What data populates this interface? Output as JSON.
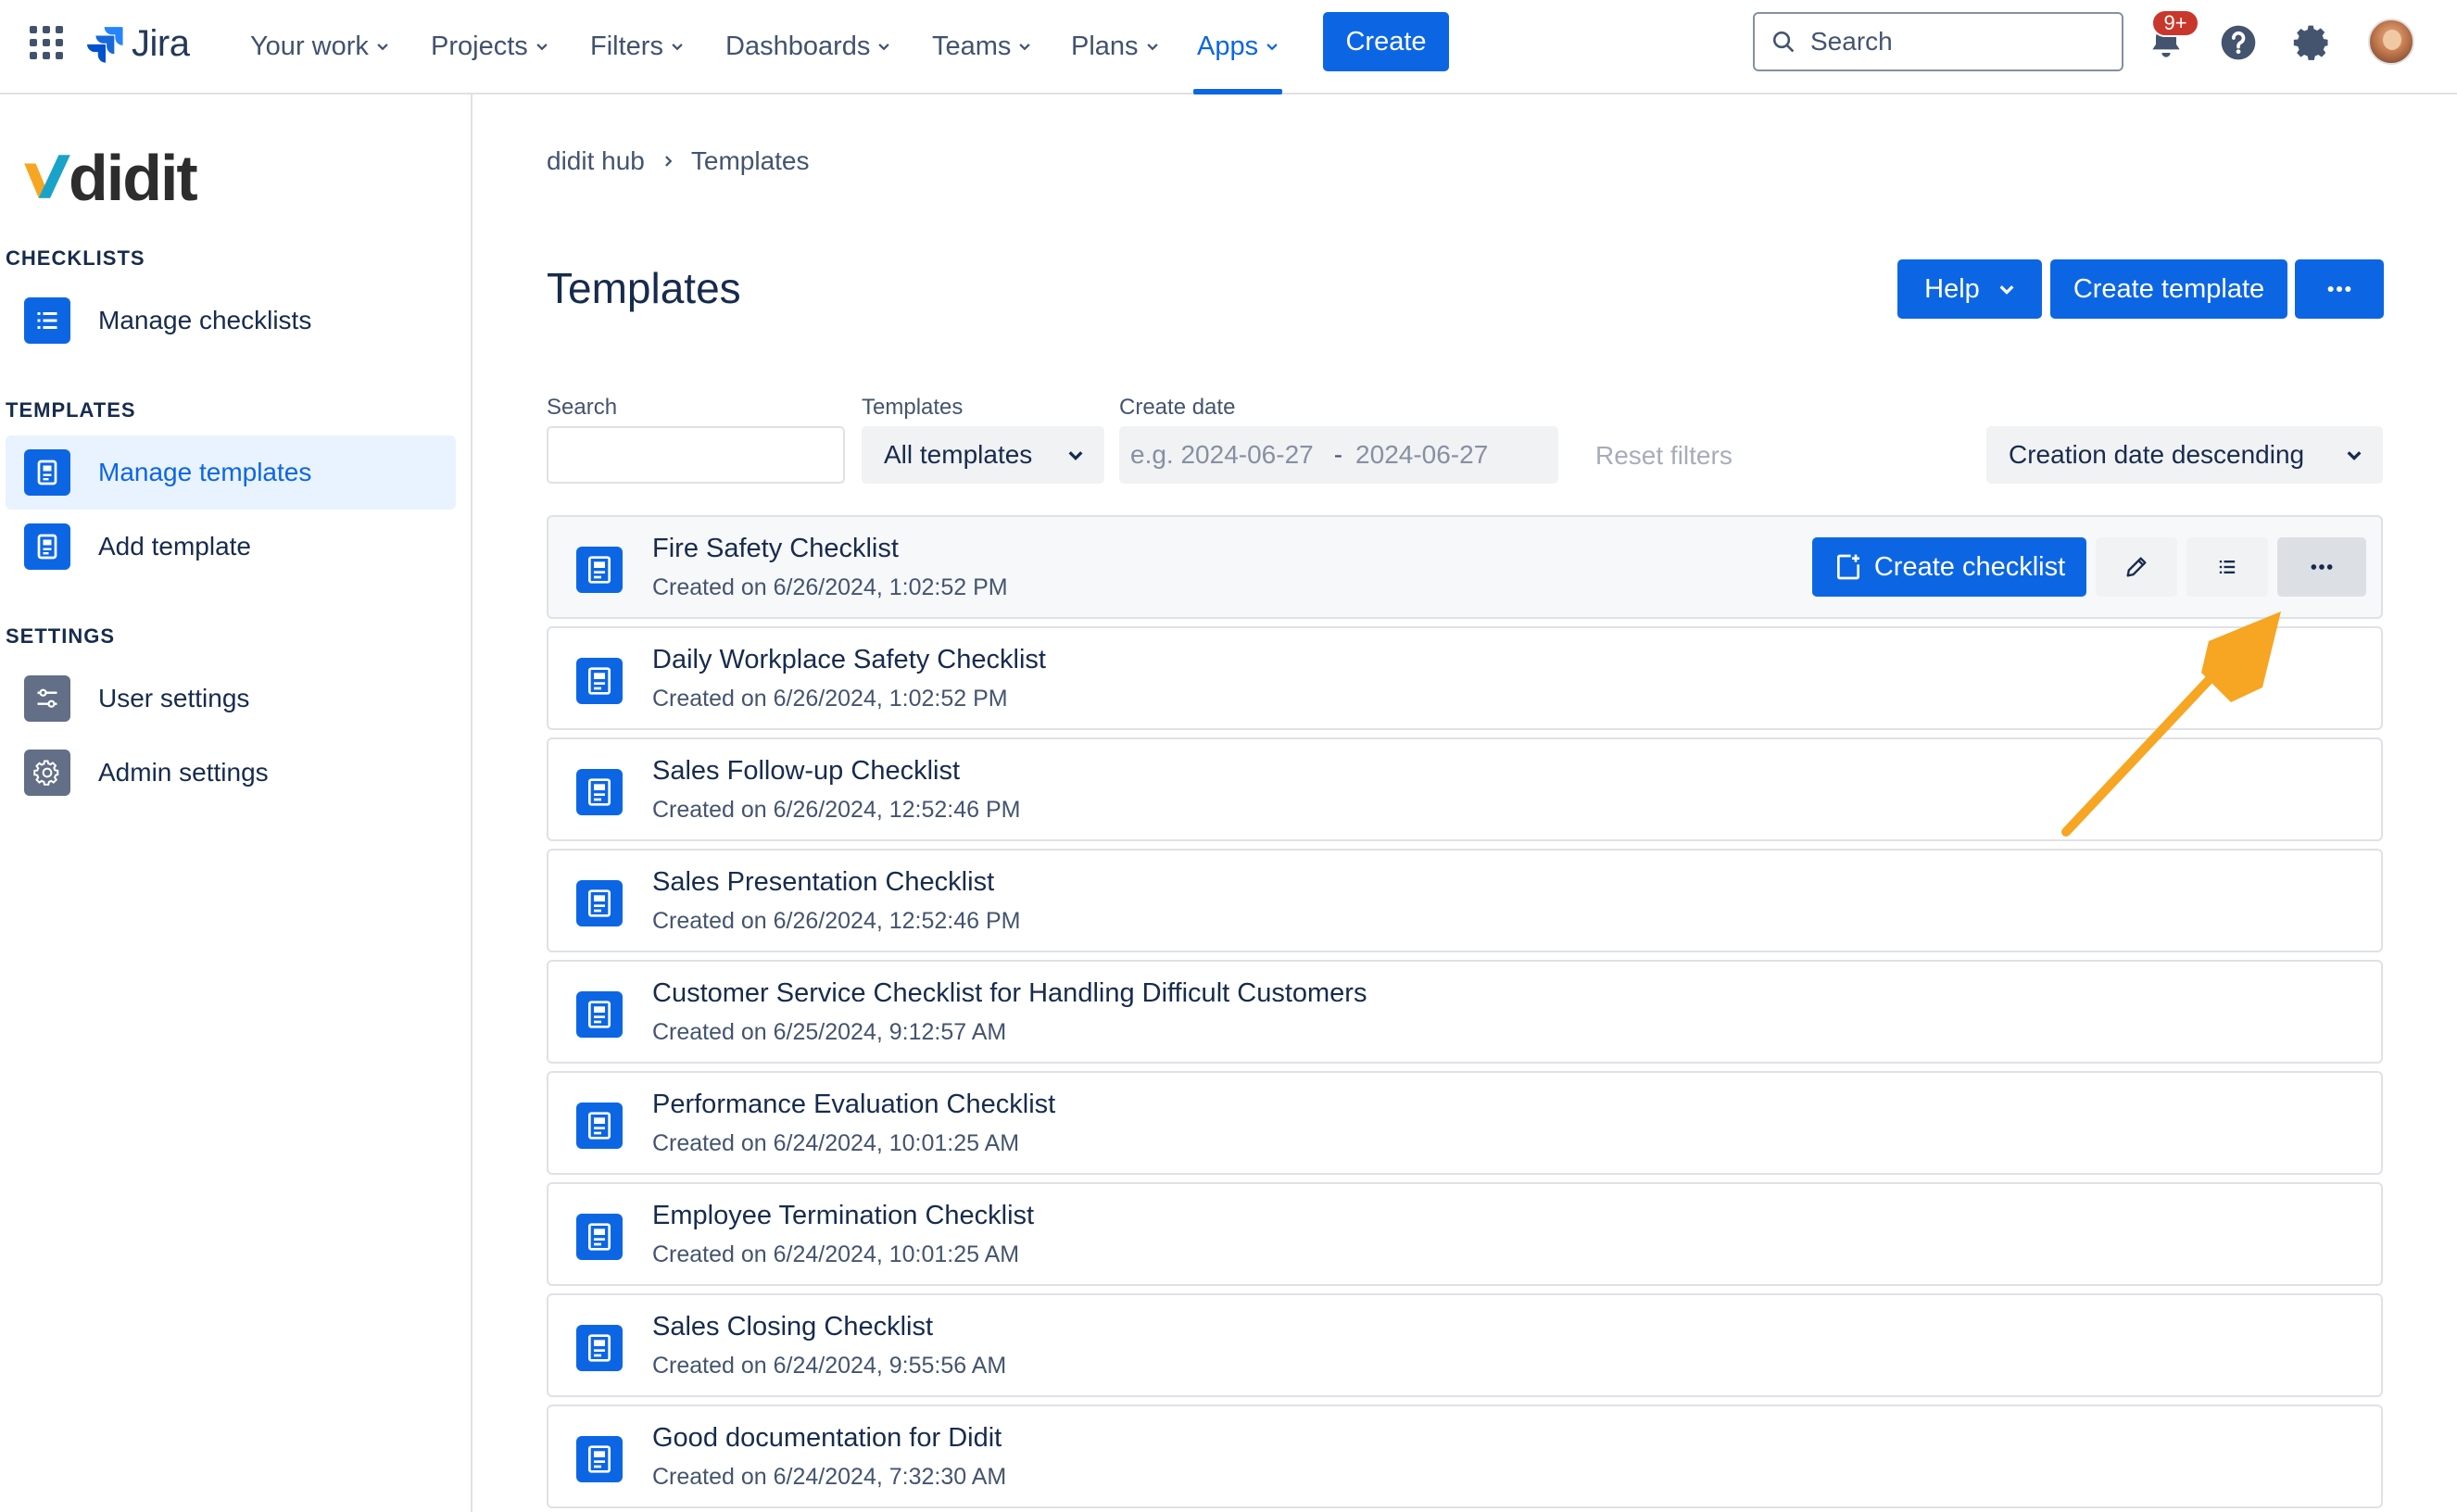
{
  "topnav": {
    "brand": "Jira",
    "items": [
      {
        "label": "Your work"
      },
      {
        "label": "Projects"
      },
      {
        "label": "Filters"
      },
      {
        "label": "Dashboards"
      },
      {
        "label": "Teams"
      },
      {
        "label": "Plans"
      },
      {
        "label": "Apps"
      }
    ],
    "create_label": "Create",
    "search_placeholder": "Search",
    "notification_count": "9+"
  },
  "sidebar": {
    "brand": "didit",
    "sections": [
      {
        "title": "CHECKLISTS",
        "items": [
          {
            "label": "Manage checklists",
            "icon": "list-icon"
          }
        ]
      },
      {
        "title": "TEMPLATES",
        "items": [
          {
            "label": "Manage templates",
            "icon": "template-icon"
          },
          {
            "label": "Add template",
            "icon": "template-icon"
          }
        ]
      },
      {
        "title": "SETTINGS",
        "items": [
          {
            "label": "User settings",
            "icon": "sliders-icon"
          },
          {
            "label": "Admin settings",
            "icon": "gear-icon"
          }
        ]
      }
    ]
  },
  "breadcrumb": {
    "root": "didit hub",
    "current": "Templates"
  },
  "page": {
    "title": "Templates",
    "help_label": "Help",
    "create_template_label": "Create template"
  },
  "filters": {
    "search_label": "Search",
    "search_value": "",
    "templates_label": "Templates",
    "templates_value": "All templates",
    "date_label": "Create date",
    "date_from_placeholder": "e.g. 2024-06-27",
    "date_to_placeholder": "2024-06-27",
    "reset_label": "Reset filters",
    "sort_value": "Creation date descending"
  },
  "row_actions": {
    "create_checklist_label": "Create checklist"
  },
  "templates": [
    {
      "title": "Fire Safety Checklist",
      "created": "Created on 6/26/2024, 1:02:52 PM"
    },
    {
      "title": "Daily Workplace Safety Checklist",
      "created": "Created on 6/26/2024, 1:02:52 PM"
    },
    {
      "title": "Sales Follow-up Checklist",
      "created": "Created on 6/26/2024, 12:52:46 PM"
    },
    {
      "title": "Sales Presentation Checklist",
      "created": "Created on 6/26/2024, 12:52:46 PM"
    },
    {
      "title": "Customer Service Checklist for Handling Difficult Customers",
      "created": "Created on 6/25/2024, 9:12:57 AM"
    },
    {
      "title": "Performance Evaluation Checklist",
      "created": "Created on 6/24/2024, 10:01:25 AM"
    },
    {
      "title": "Employee Termination Checklist",
      "created": "Created on 6/24/2024, 10:01:25 AM"
    },
    {
      "title": "Sales Closing Checklist",
      "created": "Created on 6/24/2024, 9:55:56 AM"
    },
    {
      "title": "Good documentation for Didit",
      "created": "Created on 6/24/2024, 7:32:30 AM"
    }
  ],
  "colors": {
    "primary": "#0c66e4",
    "annotation_arrow": "#f6a623",
    "badge": "#c9372c"
  }
}
